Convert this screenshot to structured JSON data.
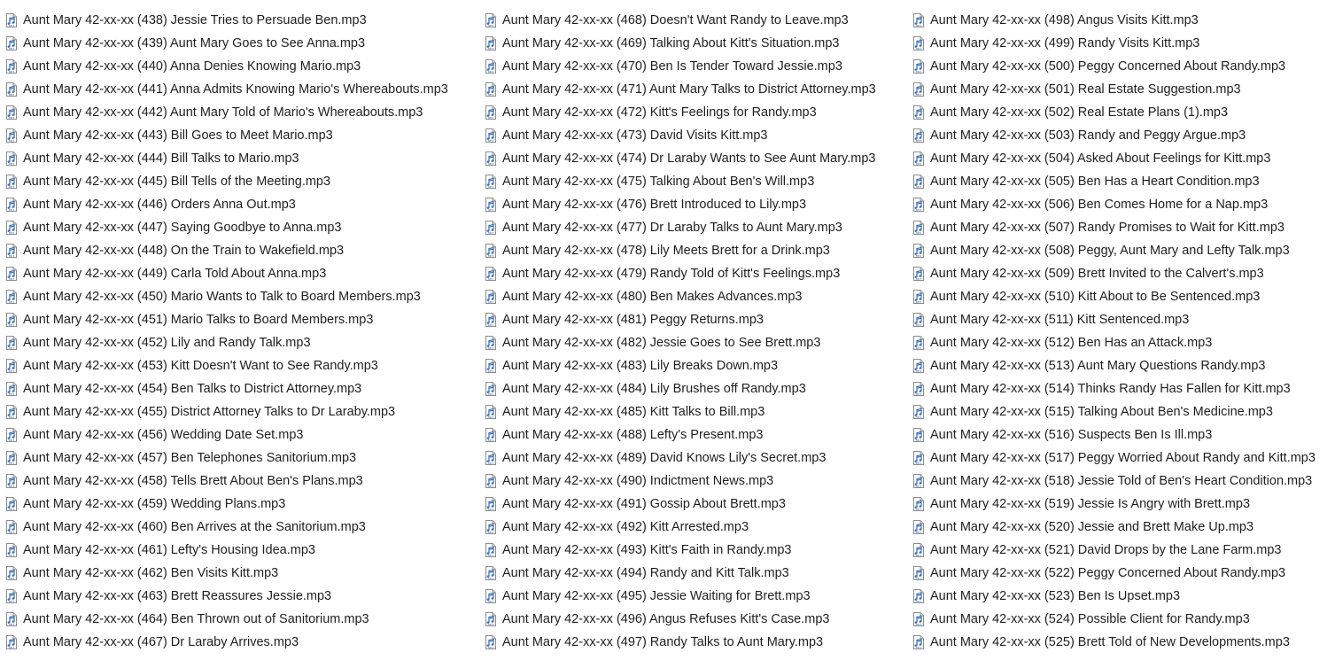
{
  "window": {
    "view": "file-list"
  },
  "icon": {
    "name": "mp3-file-icon",
    "label": "MP3",
    "colors": {
      "page": "#ffffff",
      "border": "#8c8c8c",
      "fold": "#d9d9d9",
      "note": "#3a6fb8"
    }
  },
  "columns": [
    [
      "Aunt Mary 42-xx-xx (438) Jessie Tries to Persuade Ben.mp3",
      "Aunt Mary 42-xx-xx (439) Aunt Mary Goes to See Anna.mp3",
      "Aunt Mary 42-xx-xx (440) Anna Denies Knowing Mario.mp3",
      "Aunt Mary 42-xx-xx (441) Anna Admits Knowing Mario's Whereabouts.mp3",
      "Aunt Mary 42-xx-xx (442) Aunt Mary Told of Mario's Whereabouts.mp3",
      "Aunt Mary 42-xx-xx (443) Bill Goes to Meet Mario.mp3",
      "Aunt Mary 42-xx-xx (444) Bill Talks to Mario.mp3",
      "Aunt Mary 42-xx-xx (445) Bill Tells of the Meeting.mp3",
      "Aunt Mary 42-xx-xx (446) Orders Anna Out.mp3",
      "Aunt Mary 42-xx-xx (447) Saying Goodbye to Anna.mp3",
      "Aunt Mary 42-xx-xx (448) On the Train to Wakefield.mp3",
      "Aunt Mary 42-xx-xx (449) Carla Told About Anna.mp3",
      "Aunt Mary 42-xx-xx (450) Mario Wants to Talk to Board Members.mp3",
      "Aunt Mary 42-xx-xx (451) Mario Talks to Board Members.mp3",
      "Aunt Mary 42-xx-xx (452) Lily and Randy Talk.mp3",
      "Aunt Mary 42-xx-xx (453) Kitt Doesn't Want to See Randy.mp3",
      "Aunt Mary 42-xx-xx (454) Ben Talks to District Attorney.mp3",
      "Aunt Mary 42-xx-xx (455) District Attorney Talks to Dr Laraby.mp3",
      "Aunt Mary 42-xx-xx (456) Wedding Date Set.mp3",
      "Aunt Mary 42-xx-xx (457) Ben Telephones Sanitorium.mp3",
      "Aunt Mary 42-xx-xx (458) Tells Brett About Ben's Plans.mp3",
      "Aunt Mary 42-xx-xx (459) Wedding Plans.mp3",
      "Aunt Mary 42-xx-xx (460) Ben Arrives at the Sanitorium.mp3",
      "Aunt Mary 42-xx-xx (461) Lefty's Housing Idea.mp3",
      "Aunt Mary 42-xx-xx (462) Ben Visits Kitt.mp3",
      "Aunt Mary 42-xx-xx (463) Brett Reassures Jessie.mp3",
      "Aunt Mary 42-xx-xx (464) Ben Thrown out of Sanitorium.mp3",
      "Aunt Mary 42-xx-xx (467) Dr Laraby Arrives.mp3"
    ],
    [
      "Aunt Mary 42-xx-xx (468) Doesn't Want Randy to Leave.mp3",
      "Aunt Mary 42-xx-xx (469) Talking About Kitt's Situation.mp3",
      "Aunt Mary 42-xx-xx (470) Ben Is Tender Toward Jessie.mp3",
      "Aunt Mary 42-xx-xx (471) Aunt Mary Talks to District Attorney.mp3",
      "Aunt Mary 42-xx-xx (472) Kitt's Feelings for Randy.mp3",
      "Aunt Mary 42-xx-xx (473) David Visits Kitt.mp3",
      "Aunt Mary 42-xx-xx (474) Dr Laraby Wants to See Aunt Mary.mp3",
      "Aunt Mary 42-xx-xx (475) Talking About Ben's Will.mp3",
      "Aunt Mary 42-xx-xx (476) Brett Introduced to Lily.mp3",
      "Aunt Mary 42-xx-xx (477) Dr Laraby Talks to Aunt Mary.mp3",
      "Aunt Mary 42-xx-xx (478) Lily Meets Brett for a Drink.mp3",
      "Aunt Mary 42-xx-xx (479) Randy Told of Kitt's Feelings.mp3",
      "Aunt Mary 42-xx-xx (480) Ben Makes Advances.mp3",
      "Aunt Mary 42-xx-xx (481) Peggy Returns.mp3",
      "Aunt Mary 42-xx-xx (482) Jessie Goes to See Brett.mp3",
      "Aunt Mary 42-xx-xx (483) Lily Breaks Down.mp3",
      "Aunt Mary 42-xx-xx (484) Lily Brushes off Randy.mp3",
      "Aunt Mary 42-xx-xx (485) Kitt Talks to Bill.mp3",
      "Aunt Mary 42-xx-xx (488) Lefty's Present.mp3",
      "Aunt Mary 42-xx-xx (489) David Knows Lily's Secret.mp3",
      "Aunt Mary 42-xx-xx (490) Indictment News.mp3",
      "Aunt Mary 42-xx-xx (491) Gossip About Brett.mp3",
      "Aunt Mary 42-xx-xx (492) Kitt Arrested.mp3",
      "Aunt Mary 42-xx-xx (493) Kitt's Faith in Randy.mp3",
      "Aunt Mary 42-xx-xx (494) Randy and Kitt Talk.mp3",
      "Aunt Mary 42-xx-xx (495) Jessie Waiting for Brett.mp3",
      "Aunt Mary 42-xx-xx (496) Angus Refuses Kitt's Case.mp3",
      "Aunt Mary 42-xx-xx (497) Randy Talks to Aunt Mary.mp3"
    ],
    [
      "Aunt Mary 42-xx-xx (498) Angus Visits Kitt.mp3",
      "Aunt Mary 42-xx-xx (499) Randy Visits Kitt.mp3",
      "Aunt Mary 42-xx-xx (500) Peggy Concerned About Randy.mp3",
      "Aunt Mary 42-xx-xx (501) Real Estate Suggestion.mp3",
      "Aunt Mary 42-xx-xx (502) Real Estate Plans (1).mp3",
      "Aunt Mary 42-xx-xx (503) Randy and Peggy Argue.mp3",
      "Aunt Mary 42-xx-xx (504) Asked About Feelings for Kitt.mp3",
      "Aunt Mary 42-xx-xx (505) Ben Has a Heart Condition.mp3",
      "Aunt Mary 42-xx-xx (506) Ben Comes Home for a Nap.mp3",
      "Aunt Mary 42-xx-xx (507) Randy Promises to Wait for Kitt.mp3",
      "Aunt Mary 42-xx-xx (508) Peggy, Aunt Mary and Lefty Talk.mp3",
      "Aunt Mary 42-xx-xx (509) Brett Invited to the Calvert's.mp3",
      "Aunt Mary 42-xx-xx (510) Kitt About to Be Sentenced.mp3",
      "Aunt Mary 42-xx-xx (511) Kitt Sentenced.mp3",
      "Aunt Mary 42-xx-xx (512) Ben Has an Attack.mp3",
      "Aunt Mary 42-xx-xx (513) Aunt Mary Questions Randy.mp3",
      "Aunt Mary 42-xx-xx (514) Thinks Randy Has Fallen for Kitt.mp3",
      "Aunt Mary 42-xx-xx (515) Talking About Ben's Medicine.mp3",
      "Aunt Mary 42-xx-xx (516) Suspects Ben Is Ill.mp3",
      "Aunt Mary 42-xx-xx (517) Peggy Worried About Randy and Kitt.mp3",
      "Aunt Mary 42-xx-xx (518) Jessie Told of Ben's Heart Condition.mp3",
      "Aunt Mary 42-xx-xx (519) Jessie Is Angry with Brett.mp3",
      "Aunt Mary 42-xx-xx (520) Jessie and Brett Make Up.mp3",
      "Aunt Mary 42-xx-xx (521) David Drops by the Lane Farm.mp3",
      "Aunt Mary 42-xx-xx (522) Peggy Concerned About Randy.mp3",
      "Aunt Mary 42-xx-xx (523) Ben Is Upset.mp3",
      "Aunt Mary 42-xx-xx (524) Possible Client for Randy.mp3",
      "Aunt Mary 42-xx-xx (525) Brett Told of New Developments.mp3"
    ]
  ]
}
